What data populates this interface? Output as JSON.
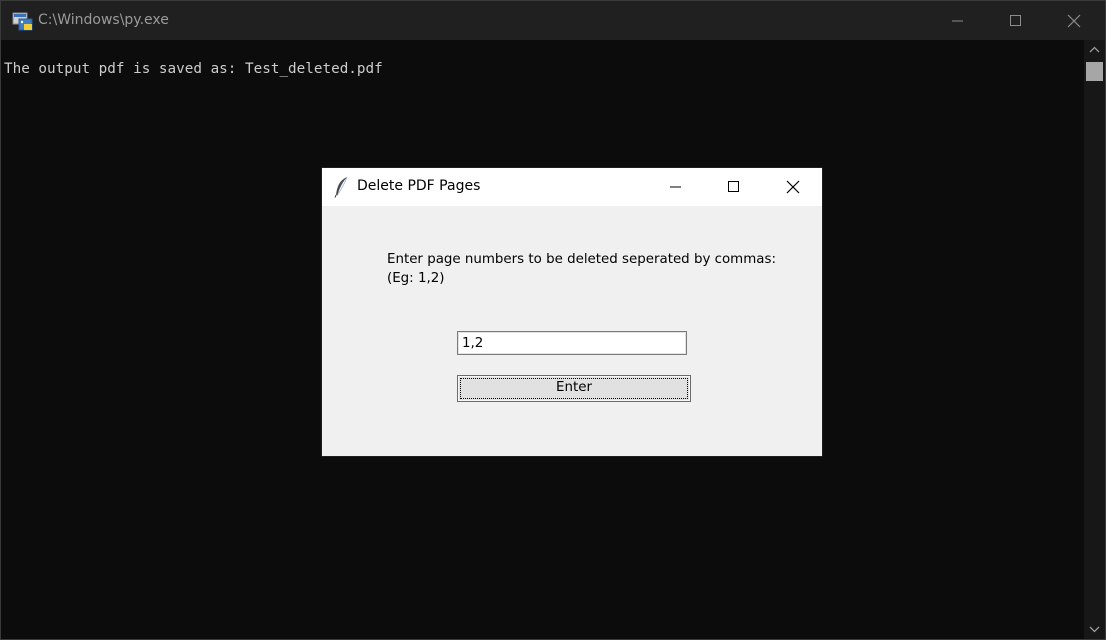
{
  "console": {
    "title": "C:\\Windows\\py.exe",
    "output_line": "The output pdf is saved as: Test_deleted.pdf",
    "controls": {
      "minimize_icon": "minimize-icon",
      "maximize_icon": "maximize-icon",
      "close_icon": "close-icon"
    },
    "colors": {
      "background": "#0c0c0c",
      "text": "#cccccc",
      "titlebar": "#202020"
    }
  },
  "dialog": {
    "title": "Delete PDF Pages",
    "icon": "feather-icon",
    "prompt_line1": "Enter page numbers to be deleted seperated by commas:",
    "prompt_line2": "(Eg: 1,2)",
    "input_value": "1,2",
    "button_label": "Enter",
    "colors": {
      "background": "#f0f0f0",
      "titlebar": "#ffffff"
    }
  }
}
